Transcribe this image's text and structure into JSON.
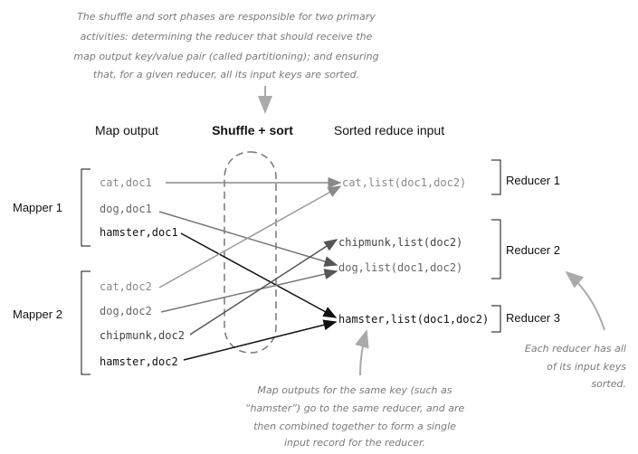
{
  "top_note": [
    "The shuffle and sort phases are responsible for two primary",
    "activities: determining the reducer that should receive the",
    "map output key/value pair (called partitioning); and ensuring",
    "that, for a given reducer, all its input keys are sorted."
  ],
  "headers": {
    "map_output": "Map output",
    "shuffle": "Shuffle + sort",
    "sorted": "Sorted reduce input"
  },
  "mappers": [
    "Mapper 1",
    "Mapper 2"
  ],
  "map_items": [
    "cat,doc1",
    "dog,doc1",
    "hamster,doc1",
    "cat,doc2",
    "dog,doc2",
    "chipmunk,doc2",
    "hamster,doc2"
  ],
  "reduce_items": [
    "cat,list(doc1,doc2)",
    "chipmunk,list(doc2)",
    "dog,list(doc1,doc2)",
    "hamster,list(doc1,doc2)"
  ],
  "reducers": [
    "Reducer 1",
    "Reducer 2",
    "Reducer 3"
  ],
  "bottom_note": [
    "Map outputs for the same key (such as",
    "“hamster”) go to the same reducer, and are",
    "then combined together to form a single",
    "input record for the reducer."
  ],
  "right_note": [
    "Each reducer has all",
    "of its input keys",
    "sorted."
  ]
}
